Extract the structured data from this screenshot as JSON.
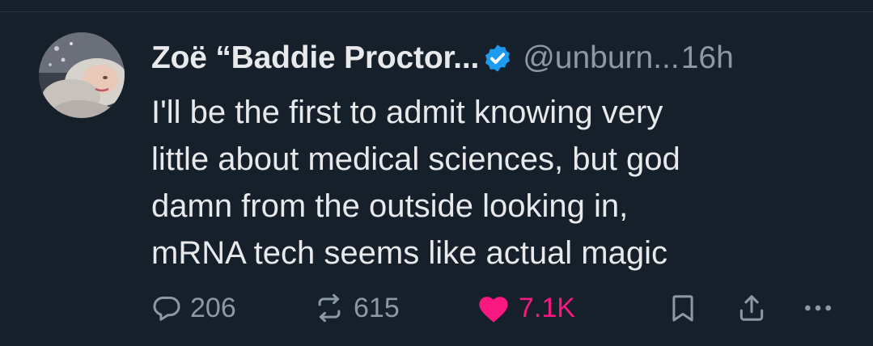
{
  "tweet": {
    "author": {
      "display_name": "Zoë “Baddie Proctor...",
      "handle": "@unburn...",
      "verified": true,
      "avatar_icon": "profile-photo"
    },
    "time": "16h",
    "text_lines": [
      "I'll be the first to admit knowing very",
      "little about medical sciences, but god",
      "damn from the outside looking in,",
      "mRNA tech seems like actual magic"
    ],
    "actions": {
      "reply": {
        "icon": "reply-icon",
        "count": "206"
      },
      "retweet": {
        "icon": "retweet-icon",
        "count": "615"
      },
      "like": {
        "icon": "heart-icon",
        "count": "7.1K",
        "liked": true
      },
      "bookmark": {
        "icon": "bookmark-icon"
      },
      "share": {
        "icon": "share-icon"
      },
      "more": {
        "icon": "more-icon"
      }
    }
  },
  "colors": {
    "background": "#15202b",
    "text_primary": "#e7e9ea",
    "text_secondary": "#8b98a5",
    "verified_blue": "#1d9bf0",
    "like_pink": "#f91880"
  }
}
